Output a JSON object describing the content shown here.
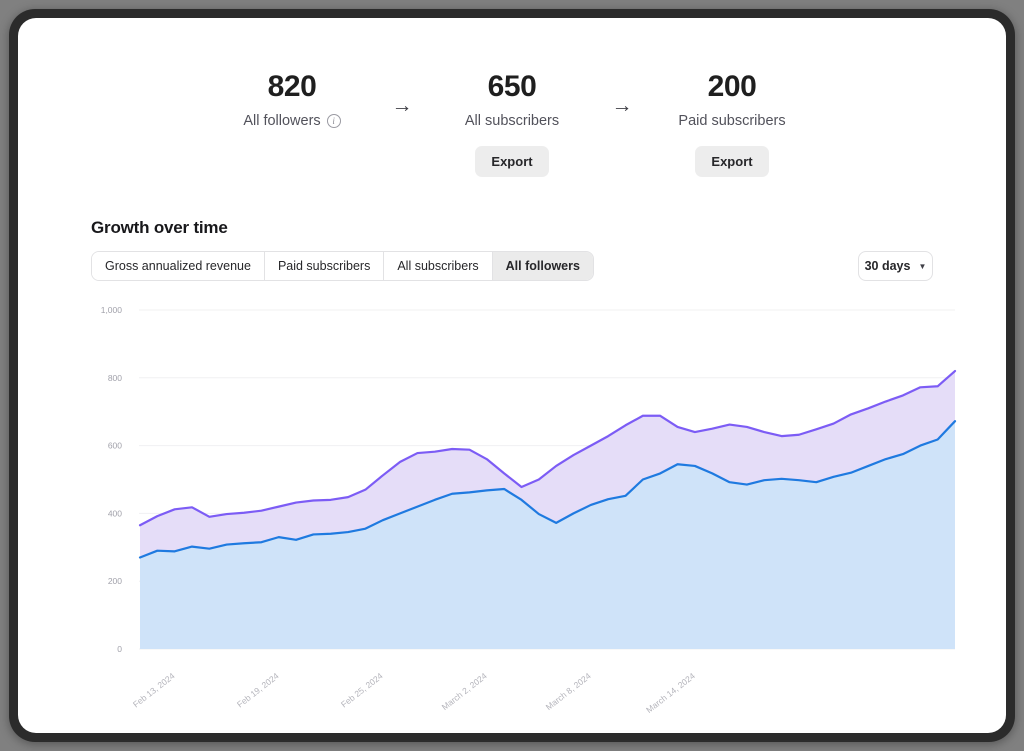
{
  "stats": [
    {
      "value": "820",
      "label": "All followers",
      "has_info_icon": true,
      "export_label": null
    },
    {
      "value": "650",
      "label": "All subscribers",
      "has_info_icon": false,
      "export_label": "Export"
    },
    {
      "value": "200",
      "label": "Paid subscribers",
      "has_info_icon": false,
      "export_label": "Export"
    }
  ],
  "arrow_glyph": "→",
  "info_glyph": "i",
  "growth": {
    "title": "Growth over time",
    "tabs": [
      {
        "label": "Gross annualized revenue",
        "active": false
      },
      {
        "label": "Paid subscribers",
        "active": false
      },
      {
        "label": "All subscribers",
        "active": false
      },
      {
        "label": "All followers",
        "active": true
      }
    ],
    "range": {
      "label": "30 days",
      "caret": "▼"
    }
  },
  "colors": {
    "followers_line": "#7c5cf5",
    "followers_fill": "#e5ddf8",
    "subscribers_line": "#1f7ae0",
    "subscribers_fill": "#cfe3f9",
    "grid": "#f0f0f2",
    "frame": "#2b2b2b",
    "page_bg": "#808080"
  },
  "chart_data": {
    "type": "area",
    "stacked": false,
    "title": "Growth over time",
    "xlabel": "",
    "ylabel": "",
    "ylim": [
      0,
      1000
    ],
    "y_ticks": [
      0,
      200,
      400,
      600,
      800,
      1000
    ],
    "y_tick_labels": [
      "0",
      "200",
      "400",
      "600",
      "800",
      "1,000"
    ],
    "grid": true,
    "legend": null,
    "x_tick_labels": [
      "Feb 13, 2024",
      "Feb 19, 2024",
      "Feb 25, 2024",
      "March 2, 2024",
      "March 8, 2024",
      "March 14, 2024"
    ],
    "x_tick_indices": [
      1,
      7,
      13,
      19,
      25,
      31
    ],
    "x": [
      "Feb 12, 2024",
      "Feb 13, 2024",
      "Feb 14, 2024",
      "Feb 15, 2024",
      "Feb 16, 2024",
      "Feb 17, 2024",
      "Feb 18, 2024",
      "Feb 19, 2024",
      "Feb 20, 2024",
      "Feb 21, 2024",
      "Feb 22, 2024",
      "Feb 23, 2024",
      "Feb 24, 2024",
      "Feb 25, 2024",
      "Feb 26, 2024",
      "Feb 27, 2024",
      "Feb 28, 2024",
      "Feb 29, 2024",
      "March 1, 2024",
      "March 2, 2024",
      "March 3, 2024",
      "March 4, 2024",
      "March 5, 2024",
      "March 6, 2024",
      "March 7, 2024",
      "March 8, 2024",
      "March 9, 2024",
      "March 10, 2024",
      "March 11, 2024",
      "March 12, 2024",
      "March 13, 2024",
      "March 14, 2024"
    ],
    "series": [
      {
        "name": "All followers",
        "line_color": "#7c5cf5",
        "fill_color": "#e5ddf8",
        "values": [
          365,
          392,
          412,
          418,
          390,
          398,
          402,
          408,
          420,
          432,
          438,
          440,
          448,
          470,
          512,
          552,
          578,
          582,
          590,
          588,
          560,
          518,
          478,
          500,
          540,
          572,
          600,
          628,
          660,
          688,
          688,
          655
        ]
      },
      {
        "name": "All subscribers",
        "line_color": "#1f7ae0",
        "fill_color": "#cfe3f9",
        "values": [
          270,
          290,
          288,
          302,
          296,
          308,
          312,
          315,
          330,
          322,
          338,
          340,
          345,
          355,
          380,
          400,
          420,
          440,
          458,
          462,
          468,
          472,
          440,
          398,
          372,
          400,
          425,
          442,
          452,
          500,
          518,
          545
        ]
      }
    ],
    "series_tail": [
      {
        "name": "All followers",
        "values": [
          640,
          650,
          662,
          655,
          640,
          628,
          632,
          648,
          665,
          692,
          710,
          730,
          748,
          772,
          775,
          820
        ]
      },
      {
        "name": "All subscribers",
        "values": [
          540,
          518,
          492,
          485,
          498,
          502,
          498,
          492,
          508,
          520,
          540,
          560,
          575,
          600,
          618,
          672
        ]
      }
    ]
  }
}
